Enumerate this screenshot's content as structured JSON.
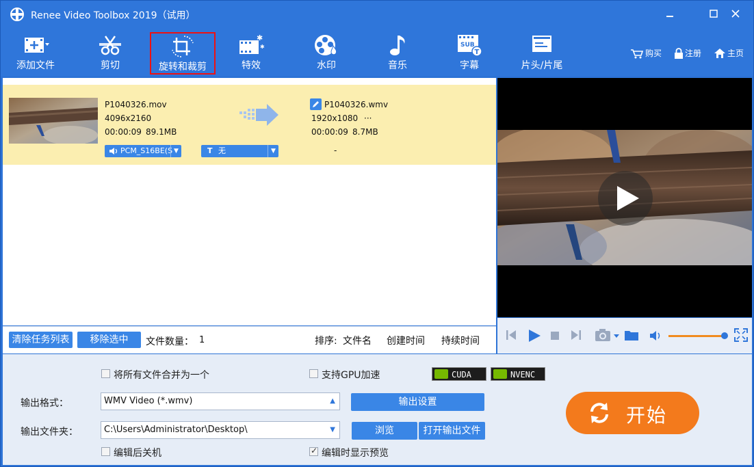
{
  "window": {
    "title": "Renee Video Toolbox 2019（试用）",
    "controls": [
      "minimize",
      "maximize",
      "close"
    ]
  },
  "toolbar": {
    "items": [
      {
        "label": "添加文件",
        "icon": "add-file-icon"
      },
      {
        "label": "剪切",
        "icon": "scissors-icon"
      },
      {
        "label": "旋转和裁剪",
        "icon": "crop-rotate-icon",
        "selected": true
      },
      {
        "label": "特效",
        "icon": "effects-icon"
      },
      {
        "label": "水印",
        "icon": "watermark-icon"
      },
      {
        "label": "音乐",
        "icon": "music-icon"
      },
      {
        "label": "字幕",
        "icon": "subtitle-icon"
      },
      {
        "label": "片头/片尾",
        "icon": "intro-outro-icon"
      }
    ],
    "right_links": {
      "buy": "购买",
      "register": "注册",
      "home": "主页"
    }
  },
  "task": {
    "source": {
      "name": "P1040326.mov",
      "resolution": "4096x2160",
      "duration": "00:00:09",
      "size": "89.1MB"
    },
    "target": {
      "name": "P1040326.wmv",
      "resolution": "1920x1080",
      "more": "···",
      "duration": "00:00:09",
      "size": "8.7MB"
    },
    "audio_track": "PCM_S16BE(S",
    "subtitle_track": "无",
    "subtitle_prefix": "T",
    "dash": "-"
  },
  "listbar": {
    "clear_label": "清除任务列表",
    "remove_label": "移除选中",
    "count_label": "文件数量：",
    "count_value": "1",
    "sort_label": "排序:",
    "sort_options": [
      "文件名",
      "创建时间",
      "持续时间"
    ]
  },
  "settings": {
    "merge_label": "将所有文件合并为一个",
    "merge_checked": false,
    "gpu_label": "支持GPU加速",
    "gpu_checked": false,
    "cuda_label": "CUDA",
    "nvenc_label": "NVENC",
    "format_label": "输出格式：",
    "format_value": "WMV Video (*.wmv)",
    "output_settings_label": "输出设置",
    "folder_label": "输出文件夹：",
    "folder_value": "C:\\Users\\Administrator\\Desktop\\",
    "browse_label": "浏览",
    "open_folder_label": "打开输出文件",
    "shutdown_label": "编辑后关机",
    "shutdown_checked": false,
    "preview_label": "编辑时显示预览",
    "preview_checked": true,
    "start_label": "开始"
  },
  "colors": {
    "brand_blue": "#2f76da",
    "task_highlight": "#fbeeb0",
    "start_orange": "#f37a1c",
    "selected_border": "#e11111"
  }
}
